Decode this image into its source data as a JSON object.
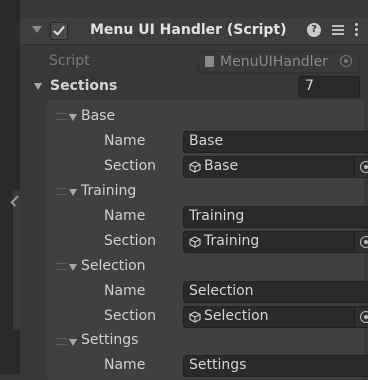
{
  "component": {
    "title": "Menu UI Handler (Script)",
    "help_icon": "help-icon",
    "preset_icon": "presets-icon",
    "more_icon": "kebab-menu-icon"
  },
  "script_row": {
    "label": "Script",
    "value": "MenuUIHandler"
  },
  "sections": {
    "label": "Sections",
    "count": "7",
    "items": [
      {
        "element_label": "Base",
        "name_label": "Name",
        "name_value": "Base",
        "section_label": "Section",
        "section_value": "Base"
      },
      {
        "element_label": "Training",
        "name_label": "Name",
        "name_value": "Training",
        "section_label": "Section",
        "section_value": "Training"
      },
      {
        "element_label": "Selection",
        "name_label": "Name",
        "name_value": "Selection",
        "section_label": "Section",
        "section_value": "Selection"
      },
      {
        "element_label": "Settings",
        "name_label": "Name",
        "name_value": "Settings"
      }
    ]
  }
}
